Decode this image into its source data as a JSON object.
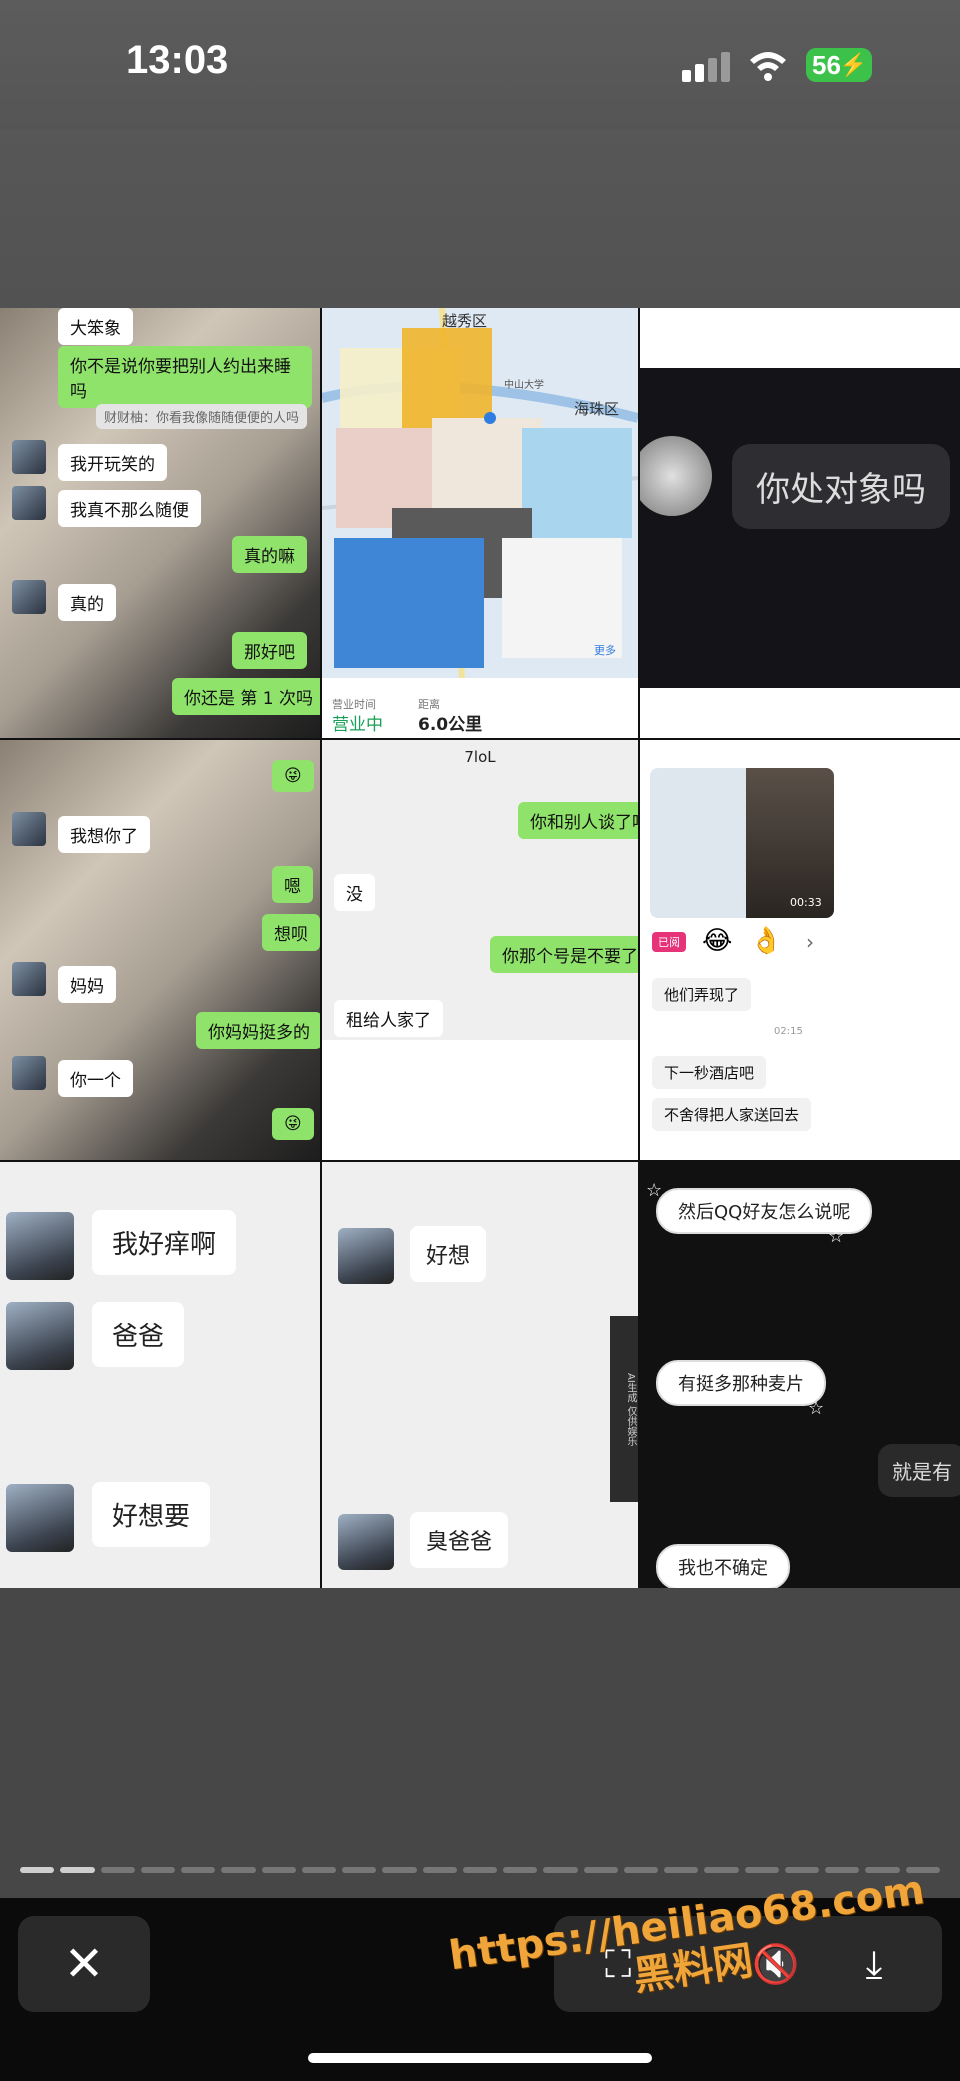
{
  "status_bar": {
    "time": "13:03",
    "battery": "56"
  },
  "collage": {
    "c1": {
      "top_label": "大笨象",
      "msg1": "你不是说你要把别人约出来睡吗",
      "quote": "财财柚：你看我像随随便便的人吗",
      "msg2": "我开玩笑的",
      "msg3": "我真不那么随便",
      "msg4": "真的嘛",
      "msg5": "真的",
      "msg6": "那好吧",
      "msg7": "你还是 第 1 次吗"
    },
    "c2": {
      "district1": "越秀区",
      "district2": "海珠区",
      "campus": "中山大学",
      "more": "更多",
      "hours_label": "营业时间",
      "hours_value": "营业中",
      "distance_label": "距离",
      "distance_value": "6.0公里"
    },
    "c3": {
      "question": "你处对象吗"
    },
    "c4": {
      "msg1": "我想你了",
      "msg2": "嗯",
      "msg3": "想呗",
      "msg4": "妈妈",
      "msg5": "你妈妈挺多的",
      "msg6": "你一个"
    },
    "c5": {
      "title": "7loL",
      "msg1": "你和别人谈了吗",
      "msg2": "没",
      "msg3": "你那个号是不要了吗",
      "msg4": "租给人家了"
    },
    "c6": {
      "video_time": "00:33",
      "badge": "已阅",
      "msg1": "他们弄现了",
      "time": "02:15",
      "msg2": "下一秒酒店吧",
      "msg3": "不舍得把人家送回去"
    },
    "c7": {
      "msg1": "我好痒啊",
      "msg2": "爸爸",
      "msg3": "好想要"
    },
    "c8": {
      "msg1": "好想",
      "msg2": "臭爸爸",
      "side_label": "AI生成 仅供娱乐"
    },
    "c9": {
      "msg1": "然后QQ好友怎么说呢",
      "msg2": "有挺多那种麦片",
      "msg3": "就是有",
      "msg4": "我也不确定"
    }
  },
  "toolbar": {
    "close_icon": "close-icon",
    "watermark_line1": "https://heiliao68.com",
    "watermark_line2": "黑料网"
  }
}
